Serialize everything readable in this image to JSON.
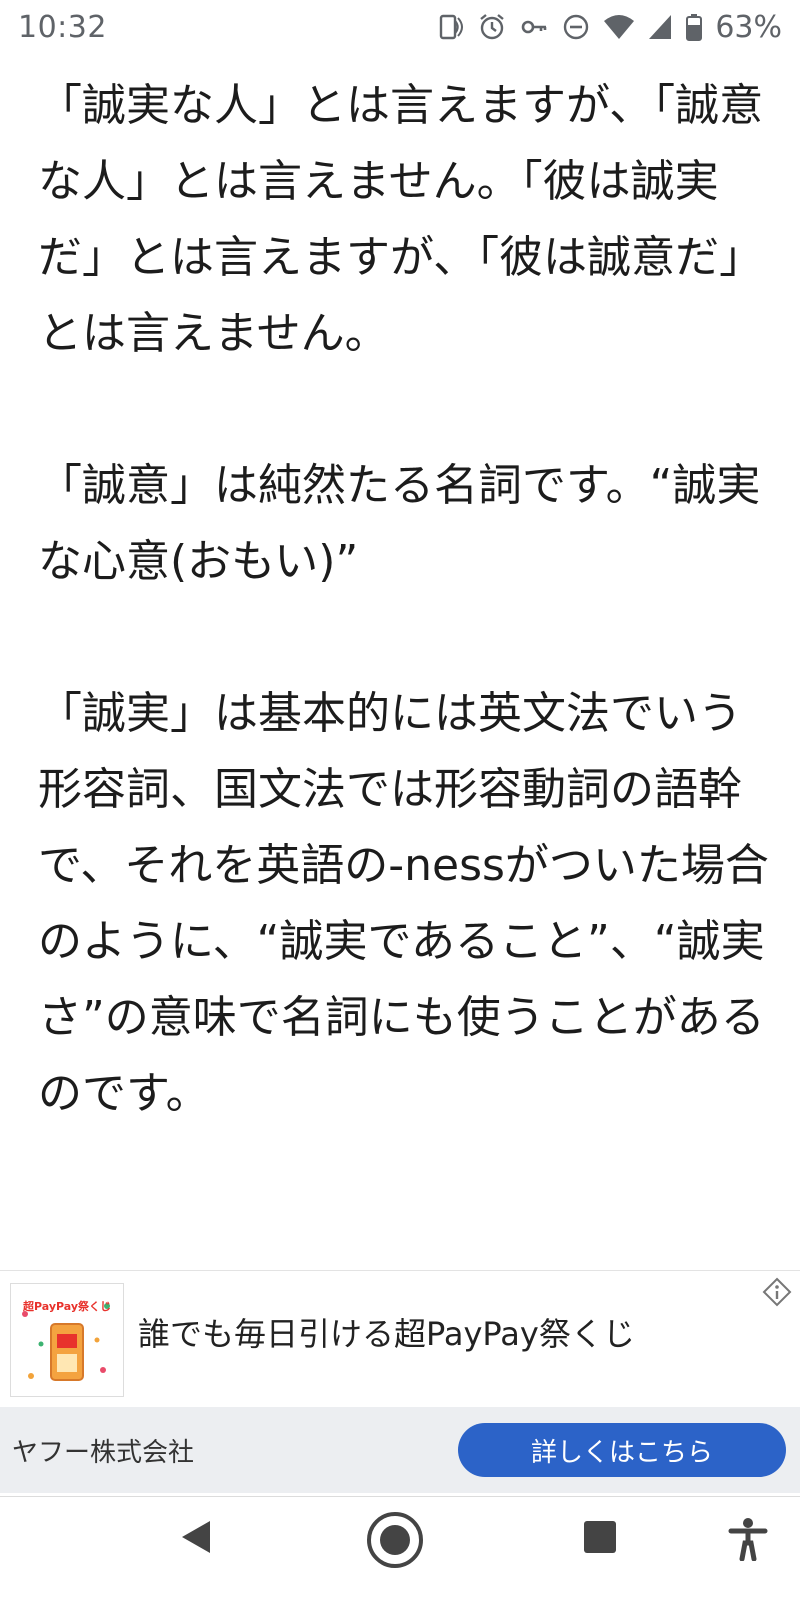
{
  "status_bar": {
    "time": "10:32",
    "battery_percent": "63%",
    "icons": [
      "nfc-icon",
      "alarm-icon",
      "key-icon",
      "dnd-icon",
      "wifi-icon",
      "signal-icon",
      "battery-icon"
    ]
  },
  "article": {
    "paragraphs": [
      "「誠実な人」とは言えますが、「誠意な人」とは言えません。「彼は誠実だ」とは言えますが、「彼は誠意だ」とは言えません。",
      "「誠意」は純然たる名詞です。“誠実な心意(おもい)”",
      "「誠実」は基本的には英文法でいう形容詞、国文法では形容動詞の語幹で、それを英語の-nessがついた場合のように、“誠実であること”、“誠実さ”の意味で名詞にも使うことがあるのです。"
    ]
  },
  "ad": {
    "title": "誰でも毎日引ける超PayPay祭くじ",
    "advertiser": "ヤフー株式会社",
    "cta_label": "詳しくはこちら",
    "thumb_text": "超PayPay祭くじ",
    "info_icon": "ad-info-icon",
    "colors": {
      "cta": "#2c63c8",
      "footer_bg": "#eceef1"
    }
  },
  "nav": {
    "icons": [
      "back-icon",
      "home-icon",
      "recents-icon",
      "accessibility-icon"
    ]
  }
}
